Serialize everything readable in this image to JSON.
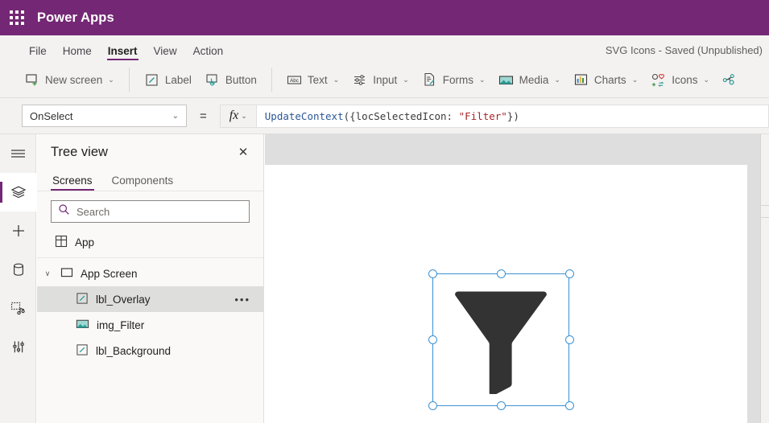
{
  "brand": {
    "waffle_icon": "app-launcher-waffle-icon",
    "title": "Power Apps"
  },
  "menu": {
    "tabs": [
      {
        "label": "File",
        "active": false
      },
      {
        "label": "Home",
        "active": false
      },
      {
        "label": "Insert",
        "active": true
      },
      {
        "label": "View",
        "active": false
      },
      {
        "label": "Action",
        "active": false
      }
    ],
    "app_state": "SVG Icons - Saved (Unpublished)"
  },
  "ribbon": {
    "items": [
      {
        "label": "New screen",
        "icon": "new-screen-icon",
        "has_chevron": true
      },
      {
        "label": "Label",
        "icon": "label-pencil-icon",
        "has_chevron": false
      },
      {
        "label": "Button",
        "icon": "button-click-icon",
        "has_chevron": false
      },
      {
        "label": "Text",
        "icon": "text-abc-icon",
        "has_chevron": true
      },
      {
        "label": "Input",
        "icon": "input-sliders-icon",
        "has_chevron": true
      },
      {
        "label": "Forms",
        "icon": "forms-document-icon",
        "has_chevron": true
      },
      {
        "label": "Media",
        "icon": "media-image-icon",
        "has_chevron": true
      },
      {
        "label": "Charts",
        "icon": "charts-bar-icon",
        "has_chevron": true
      },
      {
        "label": "Icons",
        "icon": "icons-shapes-icon",
        "has_chevron": true
      },
      {
        "label": "",
        "icon": "ai-connector-icon",
        "has_chevron": false
      }
    ],
    "chevron_glyph": "∨"
  },
  "formula_bar": {
    "property": "OnSelect",
    "property_chevron": "∨",
    "equals": "=",
    "fx_label": "fx",
    "fx_chevron": "∨",
    "formula_parts": {
      "fn": "UpdateContext",
      "open": "({locSelectedIcon: ",
      "string": "\"Filter\"",
      "close": "})"
    },
    "formula_full": "UpdateContext({locSelectedIcon: \"Filter\"})"
  },
  "rail": {
    "items": [
      {
        "name": "hamburger-menu-icon",
        "active": false
      },
      {
        "name": "tree-view-layers-icon",
        "active": true
      },
      {
        "name": "insert-plus-icon",
        "active": false
      },
      {
        "name": "data-cylinder-icon",
        "active": false
      },
      {
        "name": "media-library-icon",
        "active": false
      },
      {
        "name": "advanced-tools-icon",
        "active": false
      }
    ]
  },
  "tree_view": {
    "title": "Tree view",
    "close_glyph": "✕",
    "tabs": [
      {
        "label": "Screens",
        "active": true
      },
      {
        "label": "Components",
        "active": false
      }
    ],
    "search": {
      "placeholder": "Search",
      "value": "",
      "icon": "search-magnifier-icon"
    },
    "nodes": [
      {
        "label": "App",
        "icon": "app-grid-icon",
        "indent": 0,
        "selected": false,
        "twisty": "",
        "overflow": ""
      },
      {
        "label": "App Screen",
        "icon": "screen-rect-icon",
        "indent": 0,
        "selected": false,
        "twisty": "∨",
        "overflow": ""
      },
      {
        "label": "lbl_Overlay",
        "icon": "label-pencil-icon",
        "indent": 1,
        "selected": true,
        "twisty": "",
        "overflow": "•••"
      },
      {
        "label": "img_Filter",
        "icon": "image-icon",
        "indent": 1,
        "selected": false,
        "twisty": "",
        "overflow": ""
      },
      {
        "label": "lbl_Background",
        "icon": "label-pencil-icon",
        "indent": 1,
        "selected": false,
        "twisty": "",
        "overflow": ""
      }
    ]
  },
  "canvas": {
    "selected_control": "img_Filter",
    "shape_icon": "filter-funnel-icon",
    "shape_color": "#333333",
    "selection_color": "#3b92d4",
    "handle_count": 8
  },
  "colors": {
    "brand_purple": "#742774",
    "chrome_gray": "#f3f2f1",
    "workspace_gray": "#dedede",
    "accent_teal": "#2a9d96",
    "selection_blue": "#3b92d4"
  }
}
